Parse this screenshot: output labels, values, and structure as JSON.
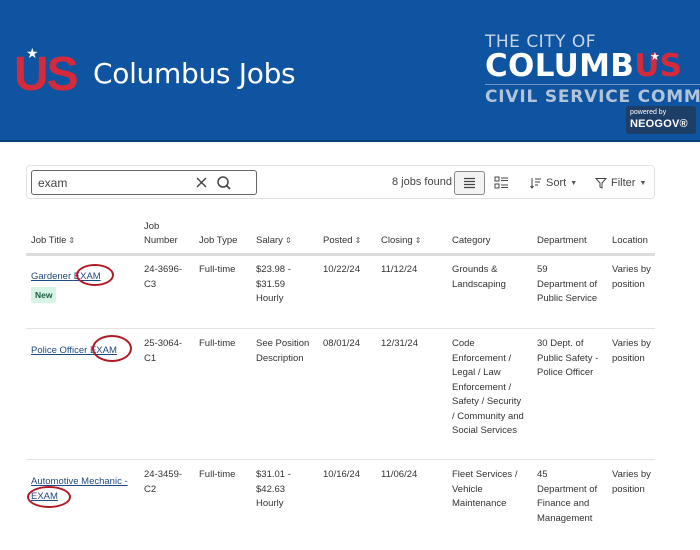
{
  "header": {
    "logo_text": "US",
    "site_title": "Columbus Jobs",
    "city_line1": "THE CITY OF",
    "city_line2_main": "COLUMB",
    "city_line2_accent": "US",
    "city_line3": "CIVIL SERVICE COMMIS",
    "powered_by": "powered by",
    "neogov": "NEOGOV®",
    "colors": {
      "background": "#0e54a0",
      "accent_red": "#d42a3c"
    }
  },
  "toolbar": {
    "search_value": "exam",
    "jobs_found": "8 jobs found",
    "sort_label": "Sort",
    "filter_label": "Filter",
    "icons": {
      "clear": "close-icon",
      "search": "search-icon",
      "list_view": "list-view-icon",
      "card_view": "card-view-icon",
      "sort": "sort-icon",
      "filter": "filter-icon"
    }
  },
  "table": {
    "columns": [
      {
        "label": "Job Title",
        "sortable": true
      },
      {
        "label": "Job Number",
        "sortable": false
      },
      {
        "label": "Job Type",
        "sortable": false
      },
      {
        "label": "Salary",
        "sortable": true
      },
      {
        "label": "Posted",
        "sortable": true
      },
      {
        "label": "Closing",
        "sortable": true
      },
      {
        "label": "Category",
        "sortable": false
      },
      {
        "label": "Department",
        "sortable": false
      },
      {
        "label": "Location",
        "sortable": false
      }
    ],
    "col_job_number_l1": "Job",
    "col_job_number_l2": "Number",
    "sort_glyph": "⇕",
    "rows": [
      {
        "title_pre": "Gardener ",
        "title_exam": "EXAM",
        "badge": "New",
        "job_number": "24-3696-C3",
        "job_type": "Full-time",
        "salary": "$23.98 - $31.59 Hourly",
        "posted": "10/22/24",
        "closing": "11/12/24",
        "category": "Grounds & Landscaping",
        "department": "59 Department of Public Service",
        "location": "Varies by position"
      },
      {
        "title_pre": "Police Officer ",
        "title_exam": "EXAM",
        "badge": null,
        "job_number": "25-3064-C1",
        "job_type": "Full-time",
        "salary": "See Position Description",
        "posted": "08/01/24",
        "closing": "12/31/24",
        "category": "Code Enforcement / Legal / Law Enforcement / Safety / Security / Community and Social Services",
        "department": "30 Dept. of Public Safety - Police Officer",
        "location": "Varies by position"
      },
      {
        "title_pre": "Automotive Mechanic ",
        "title_exam": "- EXAM",
        "badge": null,
        "job_number": "24-3459-C2",
        "job_type": "Full-time",
        "salary": "$31.01 - $42.63 Hourly",
        "posted": "10/16/24",
        "closing": "11/06/24",
        "category": "Fleet Services / Vehicle Maintenance",
        "department": "45 Department of Finance and Management",
        "location": "Varies by position"
      }
    ]
  },
  "annotation": {
    "highlight_color": "#b11a25",
    "highlight_term": "EXAM"
  }
}
